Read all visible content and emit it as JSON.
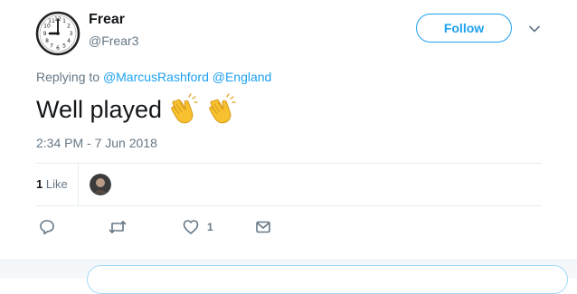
{
  "user": {
    "name": "Frear",
    "handle": "@Frear3",
    "avatar_icon": "clock-face-avatar"
  },
  "follow_label": "Follow",
  "replying": {
    "prefix": "Replying to",
    "mentions": [
      "@MarcusRashford",
      "@England"
    ]
  },
  "tweet_text": "Well played",
  "emoji": [
    "clapping-hands",
    "clapping-hands"
  ],
  "timestamp": "2:34 PM - 7 Jun 2018",
  "stats": {
    "likes_count": "1",
    "likes_label": "Like"
  },
  "actions": {
    "reply_icon": "reply-icon",
    "retweet_icon": "retweet-icon",
    "like_icon": "heart-icon",
    "like_count": "1",
    "dm_icon": "envelope-icon"
  },
  "colors": {
    "accent": "#1da1f2",
    "secondary_text": "#657786",
    "primary_text": "#14171a",
    "divider": "#e6ecf0"
  }
}
